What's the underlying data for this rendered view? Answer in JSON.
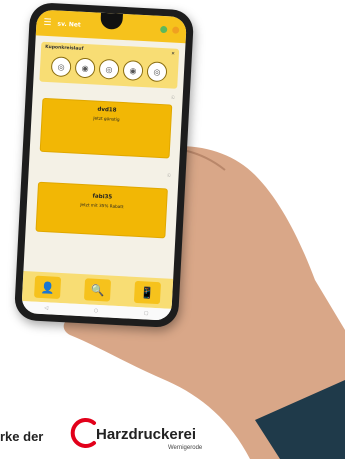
{
  "app": {
    "title": "sv. Net",
    "section_title": "Kuponkreislauf",
    "categories": [
      "cat-1",
      "cat-2",
      "cat-3",
      "cat-4",
      "cat-5"
    ],
    "items": [
      {
        "name": "dvd18",
        "meta_left": "",
        "meta_right": "",
        "text": "Jetzt günstig",
        "footer": ""
      },
      {
        "name": "fabi35",
        "meta_left": "",
        "meta_right": "",
        "text": "Jetzt mit 35% Rabatt",
        "footer": ""
      }
    ],
    "nav": [
      "◁",
      "○",
      "▢"
    ]
  },
  "brand": {
    "prefix": "rke der",
    "name": "Harzdruckerei",
    "sub": "Wernigerode",
    "accent": "#e2001a"
  }
}
